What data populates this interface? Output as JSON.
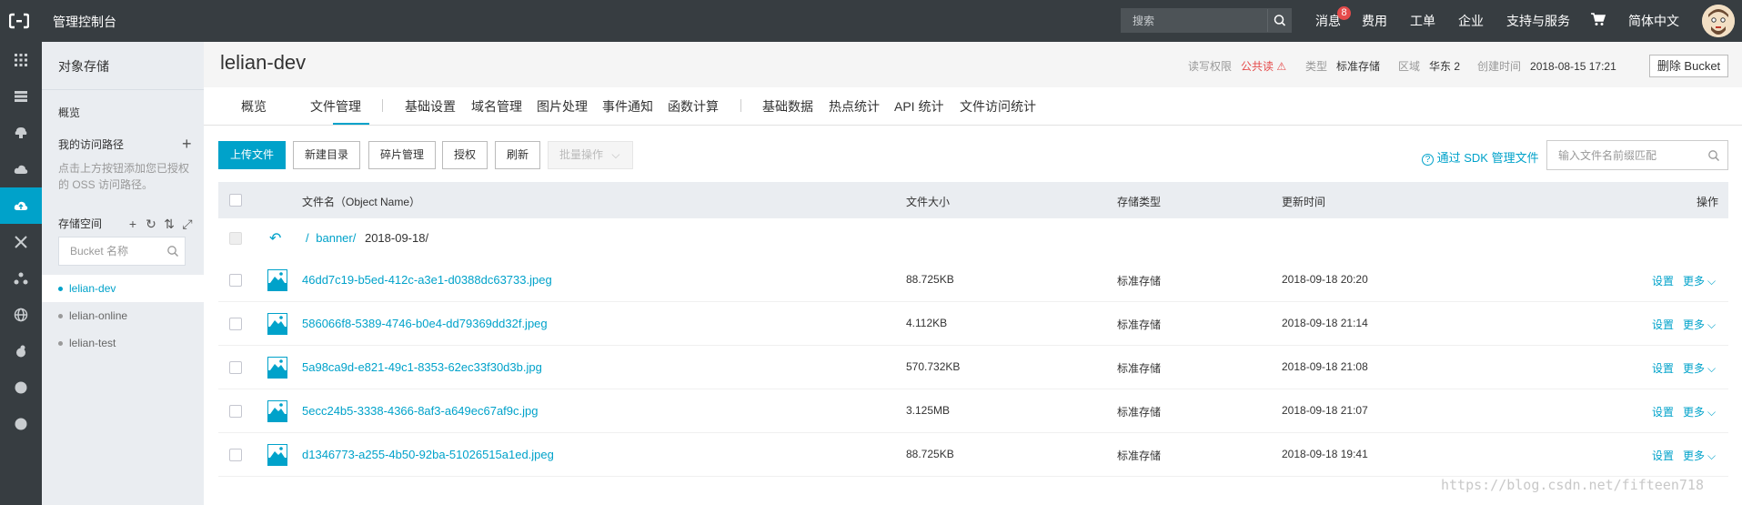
{
  "topbar": {
    "console_title": "管理控制台",
    "search_placeholder": "搜索",
    "nav": [
      "消息",
      "费用",
      "工单",
      "企业",
      "支持与服务",
      "简体中文"
    ],
    "message_count": "8",
    "icons": [
      "console-logo-icon",
      "search-icon",
      "cart-icon",
      "avatar"
    ]
  },
  "rail": {
    "icons": [
      "grid-icon",
      "list-icon",
      "cloud-server-icon",
      "cloud-icon",
      "oss-cloud-icon",
      "network-icon",
      "nodes-icon",
      "globe-icon",
      "bug-icon",
      "dot-icon",
      "dot-icon"
    ],
    "active_index": 4
  },
  "sidebar": {
    "title": "对象存储",
    "overview": "概览",
    "my_paths": "我的访问路径",
    "paths_hint": "点击上方按钮添加您已授权的 OSS 访问路径。",
    "bucket_label": "存储空间",
    "bucket_search_placeholder": "Bucket 名称",
    "buckets": [
      "lelian-dev",
      "lelian-online",
      "lelian-test"
    ],
    "active_bucket": "lelian-dev"
  },
  "header": {
    "bucket_name": "lelian-dev",
    "acl_label": "读写权限",
    "acl_value": "公共读",
    "type_label": "类型",
    "type_value": "标准存储",
    "region_label": "区域",
    "region_value": "华东 2",
    "created_label": "创建时间",
    "created_value": "2018-08-15 17:21",
    "delete_button": "删除 Bucket"
  },
  "tabs": [
    "概览",
    "文件管理",
    "基础设置",
    "域名管理",
    "图片处理",
    "事件通知",
    "函数计算",
    "基础数据",
    "热点统计",
    "API 统计",
    "文件访问统计"
  ],
  "active_tab": "文件管理",
  "toolbar": {
    "upload": "上传文件",
    "new_dir": "新建目录",
    "fragments": "碎片管理",
    "authorize": "授权",
    "refresh": "刷新",
    "batch": "批量操作",
    "sdk_link": "通过 SDK 管理文件",
    "search_placeholder": "输入文件名前缀匹配"
  },
  "table": {
    "columns": [
      "文件名（Object Name）",
      "文件大小",
      "存储类型",
      "更新时间",
      "操作"
    ],
    "path_root": "/",
    "path_dir": "banner/",
    "path_current": "2018-09-18/",
    "rows": [
      {
        "name": "46dd7c19-b5ed-412c-a3e1-d0388dc63733.jpeg",
        "size": "88.725KB",
        "storage": "标准存储",
        "updated": "2018-09-18 20:20"
      },
      {
        "name": "586066f8-5389-4746-b0e4-dd79369dd32f.jpeg",
        "size": "4.112KB",
        "storage": "标准存储",
        "updated": "2018-09-18 21:14"
      },
      {
        "name": "5a98ca9d-e821-49c1-8353-62ec33f30d3b.jpg",
        "size": "570.732KB",
        "storage": "标准存储",
        "updated": "2018-09-18 21:08"
      },
      {
        "name": "5ecc24b5-3338-4366-8af3-a649ec67af9c.jpg",
        "size": "3.125MB",
        "storage": "标准存储",
        "updated": "2018-09-18 21:07"
      },
      {
        "name": "d1346773-a255-4b50-92ba-51026515a1ed.jpeg",
        "size": "88.725KB",
        "storage": "标准存储",
        "updated": "2018-09-18 19:41"
      }
    ],
    "op_settings": "设置",
    "op_more": "更多"
  },
  "watermark": "https://blog.csdn.net/fifteen718",
  "colors": {
    "topbar": "#373d41",
    "accent": "#00a2ca",
    "sidebar": "#eaedf1",
    "warn": "#e54b4b"
  }
}
